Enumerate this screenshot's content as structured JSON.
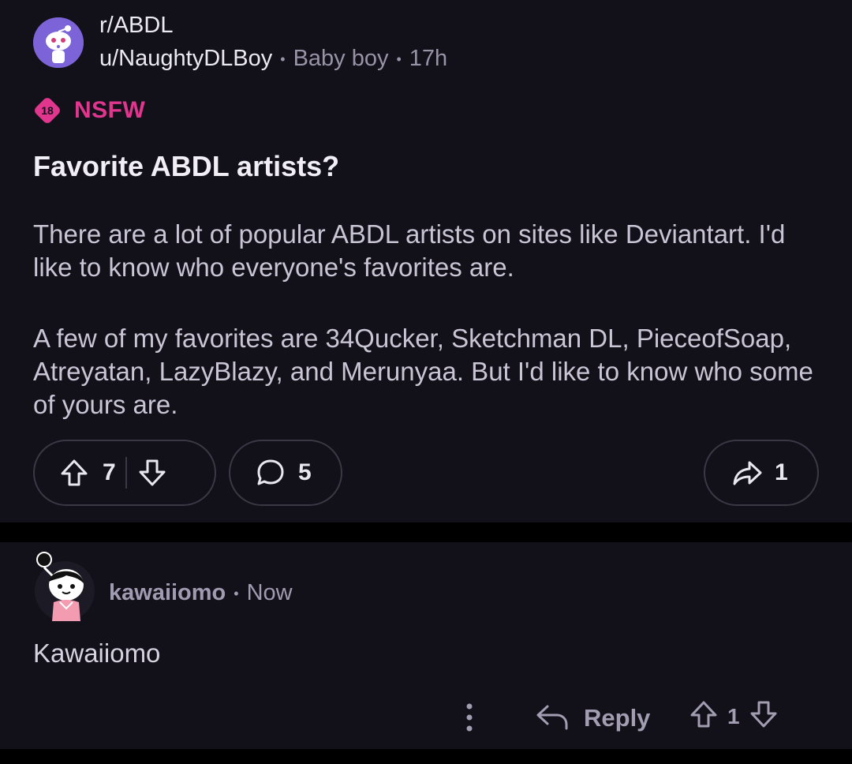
{
  "post": {
    "subreddit": "r/ABDL",
    "author": "u/NaughtyDLBoy",
    "flair": "Baby boy",
    "time": "17h",
    "nsfw_badge": "18",
    "nsfw_label": "NSFW",
    "title": "Favorite ABDL artists?",
    "body_paragraphs": [
      "There are a lot of popular ABDL artists on sites like Deviantart. I'd like to know who everyone's favorites are.",
      "A few of my favorites are 34Qucker, Sketchman DL, PieceofSoap, Atreyatan, LazyBlazy, and Merunyaa. But I'd like to know who some of yours are."
    ],
    "upvotes": "7",
    "comments": "5",
    "shares": "1"
  },
  "comment": {
    "author": "kawaiiomo",
    "time": "Now",
    "body": "Kawaiiomo",
    "reply_label": "Reply",
    "votes": "1"
  },
  "colors": {
    "background": "#121019",
    "nsfw": "#e0368e",
    "subreddit_avatar": "#7c64d8"
  },
  "icons": [
    "upvote-icon",
    "downvote-icon",
    "comment-icon",
    "share-icon",
    "more-icon",
    "reply-icon"
  ]
}
